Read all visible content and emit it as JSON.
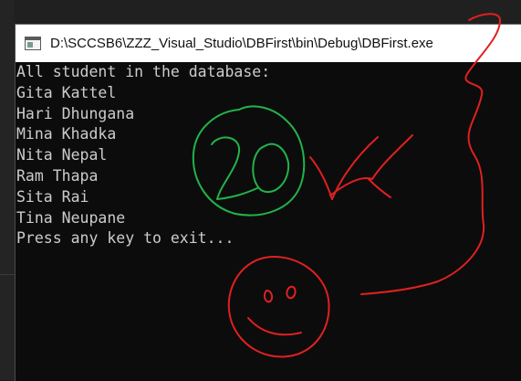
{
  "window": {
    "title": "D:\\SCCSB6\\ZZZ_Visual_Studio\\DBFirst\\bin\\Debug\\DBFirst.exe",
    "icon": "console-app-icon"
  },
  "console": {
    "lines": [
      "All student in the database:",
      "Gita Kattel",
      "Hari Dhungana",
      "Mina Khadka",
      "Nita Nepal",
      "Ram Thapa",
      "Sita Rai",
      "Tina Neupane",
      "Press any key to exit..."
    ]
  },
  "annotations": {
    "score_text": "20",
    "score_color": "#22b34a",
    "mark_color": "#e02020"
  }
}
